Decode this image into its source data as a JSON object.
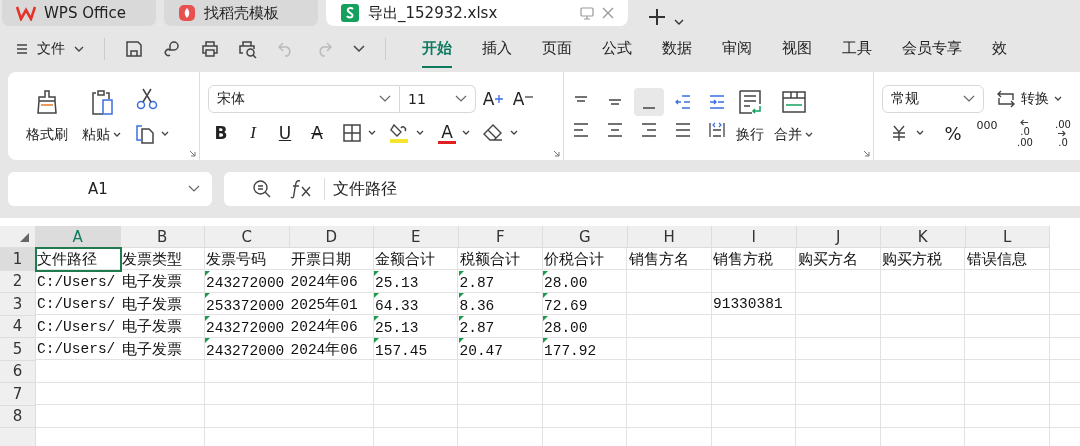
{
  "title_tabs": [
    {
      "label": "WPS Office",
      "kind": "home",
      "selected": false
    },
    {
      "label": "找稻壳模板",
      "kind": "template",
      "selected": false
    },
    {
      "label": "导出_152932.xlsx",
      "kind": "sheet",
      "selected": true
    }
  ],
  "file_menu": "文件",
  "ribbon_tabs": [
    {
      "label": "开始",
      "selected": true
    },
    {
      "label": "插入",
      "selected": false
    },
    {
      "label": "页面",
      "selected": false
    },
    {
      "label": "公式",
      "selected": false
    },
    {
      "label": "数据",
      "selected": false
    },
    {
      "label": "审阅",
      "selected": false
    },
    {
      "label": "视图",
      "selected": false
    },
    {
      "label": "工具",
      "selected": false
    },
    {
      "label": "会员专享",
      "selected": false
    },
    {
      "label": "效",
      "selected": false
    }
  ],
  "ribbon": {
    "format_painter": "格式刷",
    "paste": "粘贴",
    "font": "宋体",
    "size": "11",
    "grow": "A",
    "shrink": "A",
    "styles": [
      {
        "label": "B",
        "kind": "bold"
      },
      {
        "label": "I",
        "kind": "italic"
      },
      {
        "label": "U",
        "kind": "underline"
      },
      {
        "label": "A",
        "kind": "strike"
      }
    ],
    "font_color_letter": "A",
    "wrap": "换行",
    "merge": "合并",
    "number_format": "常规",
    "convert": "转换",
    "percent": "%",
    "thousands": "000",
    "decimals": [
      {
        "kind": "increase",
        "top": ".0",
        "bottom": ".00"
      },
      {
        "kind": "decrease",
        "top": ".00",
        "bottom": ".0"
      }
    ]
  },
  "formula_bar": {
    "cell_ref": "A1",
    "value": "文件路径"
  },
  "sheet": {
    "columns": [
      {
        "label": "A",
        "selected": true
      },
      {
        "label": "B",
        "selected": false
      },
      {
        "label": "C",
        "selected": false
      },
      {
        "label": "D",
        "selected": false
      },
      {
        "label": "E",
        "selected": false
      },
      {
        "label": "F",
        "selected": false
      },
      {
        "label": "G",
        "selected": false
      },
      {
        "label": "H",
        "selected": false
      },
      {
        "label": "I",
        "selected": false
      },
      {
        "label": "J",
        "selected": false
      },
      {
        "label": "K",
        "selected": false
      },
      {
        "label": "L",
        "selected": false
      }
    ],
    "rows": [
      {
        "label": "1",
        "selected": true,
        "cells": {
          "A": {
            "text": "文件路径",
            "selected": true,
            "flagged": false
          },
          "B": {
            "text": "发票类型",
            "selected": false,
            "flagged": false
          },
          "C": {
            "text": "发票号码",
            "selected": false,
            "flagged": false
          },
          "D": {
            "text": "开票日期",
            "selected": false,
            "flagged": false
          },
          "E": {
            "text": "金额合计",
            "selected": false,
            "flagged": false
          },
          "F": {
            "text": "税额合计",
            "selected": false,
            "flagged": false
          },
          "G": {
            "text": "价税合计",
            "selected": false,
            "flagged": false
          },
          "H": {
            "text": "销售方名",
            "selected": false,
            "flagged": false
          },
          "I": {
            "text": "销售方税",
            "selected": false,
            "flagged": false
          },
          "J": {
            "text": "购买方名",
            "selected": false,
            "flagged": false
          },
          "K": {
            "text": "购买方税",
            "selected": false,
            "flagged": false
          },
          "L": {
            "text": "错误信息",
            "selected": false,
            "flagged": false
          }
        }
      },
      {
        "label": "2",
        "selected": false,
        "cells": {
          "A": {
            "text": "C:/Users/",
            "selected": false,
            "flagged": false
          },
          "B": {
            "text": "电子发票",
            "selected": false,
            "flagged": false
          },
          "C": {
            "text": "243272000",
            "selected": false,
            "flagged": true
          },
          "D": {
            "text": "2024年06",
            "selected": false,
            "flagged": false
          },
          "E": {
            "text": "25.13",
            "selected": false,
            "flagged": true
          },
          "F": {
            "text": "2.87",
            "selected": false,
            "flagged": true
          },
          "G": {
            "text": "28.00",
            "selected": false,
            "flagged": true
          }
        }
      },
      {
        "label": "3",
        "selected": false,
        "cells": {
          "A": {
            "text": "C:/Users/",
            "selected": false,
            "flagged": false
          },
          "B": {
            "text": "电子发票",
            "selected": false,
            "flagged": false
          },
          "C": {
            "text": "253372000",
            "selected": false,
            "flagged": true
          },
          "D": {
            "text": "2025年01",
            "selected": false,
            "flagged": false
          },
          "E": {
            "text": "64.33",
            "selected": false,
            "flagged": true
          },
          "F": {
            "text": "8.36",
            "selected": false,
            "flagged": true
          },
          "G": {
            "text": "72.69",
            "selected": false,
            "flagged": true
          },
          "I": {
            "text": "91330381",
            "selected": false,
            "flagged": false
          }
        }
      },
      {
        "label": "4",
        "selected": false,
        "cells": {
          "A": {
            "text": "C:/Users/",
            "selected": false,
            "flagged": false
          },
          "B": {
            "text": "电子发票",
            "selected": false,
            "flagged": false
          },
          "C": {
            "text": "243272000",
            "selected": false,
            "flagged": true
          },
          "D": {
            "text": "2024年06",
            "selected": false,
            "flagged": false
          },
          "E": {
            "text": "25.13",
            "selected": false,
            "flagged": true
          },
          "F": {
            "text": "2.87",
            "selected": false,
            "flagged": true
          },
          "G": {
            "text": "28.00",
            "selected": false,
            "flagged": true
          }
        }
      },
      {
        "label": "5",
        "selected": false,
        "cells": {
          "A": {
            "text": "C:/Users/",
            "selected": false,
            "flagged": false
          },
          "B": {
            "text": "电子发票",
            "selected": false,
            "flagged": false
          },
          "C": {
            "text": "243272000",
            "selected": false,
            "flagged": true
          },
          "D": {
            "text": "2024年06",
            "selected": false,
            "flagged": false
          },
          "E": {
            "text": "157.45",
            "selected": false,
            "flagged": true
          },
          "F": {
            "text": "20.47",
            "selected": false,
            "flagged": true
          },
          "G": {
            "text": "177.92",
            "selected": false,
            "flagged": true
          }
        }
      },
      {
        "label": "6",
        "selected": false,
        "cells": {}
      },
      {
        "label": "7",
        "selected": false,
        "cells": {}
      },
      {
        "label": "8",
        "selected": false,
        "cells": {}
      }
    ]
  }
}
